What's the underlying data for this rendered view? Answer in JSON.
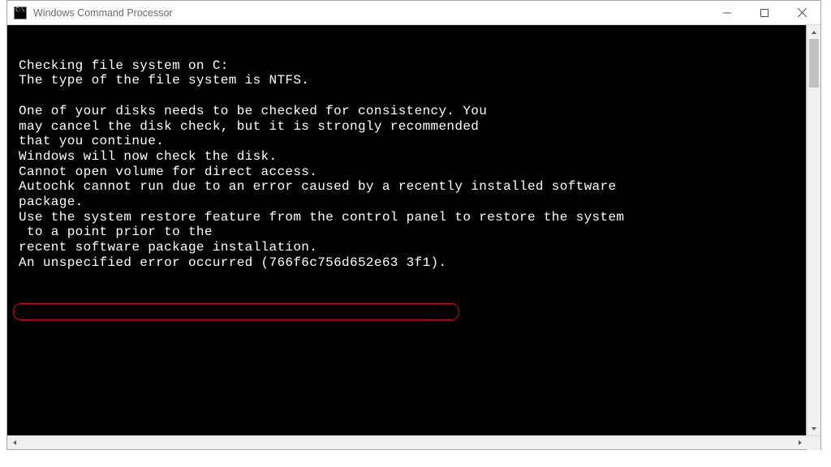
{
  "window": {
    "title": "Windows Command Processor"
  },
  "console": {
    "lines": [
      "",
      "Checking file system on C:",
      "The type of the file system is NTFS.",
      "",
      "One of your disks needs to be checked for consistency. You",
      "may cancel the disk check, but it is strongly recommended",
      "that you continue.",
      "Windows will now check the disk.",
      "Cannot open volume for direct access.",
      "Autochk cannot run due to an error caused by a recently installed software",
      "package.",
      "Use the system restore feature from the control panel to restore the system",
      " to a point prior to the",
      "recent software package installation.",
      "An unspecified error occurred (766f6c756d652e63 3f1)."
    ],
    "highlighted_line_index": 14
  }
}
